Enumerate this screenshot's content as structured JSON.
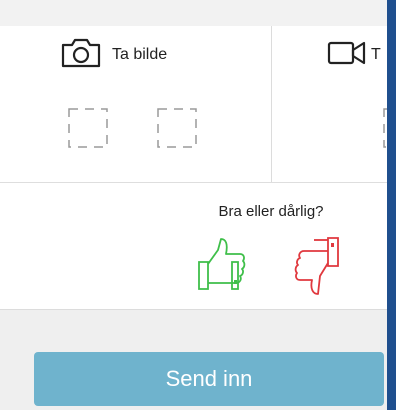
{
  "capture": {
    "photo_label": "Ta bilde",
    "video_label": "T"
  },
  "feedback": {
    "question": "Bra eller dårlig?",
    "good_color": "#3fbf4a",
    "bad_color": "#e0383e"
  },
  "submit": {
    "label": "Send inn",
    "color": "#6fb3cd"
  },
  "icons": [
    "camera-icon",
    "video-camera-icon",
    "thumbs-up-icon",
    "thumbs-down-icon"
  ]
}
